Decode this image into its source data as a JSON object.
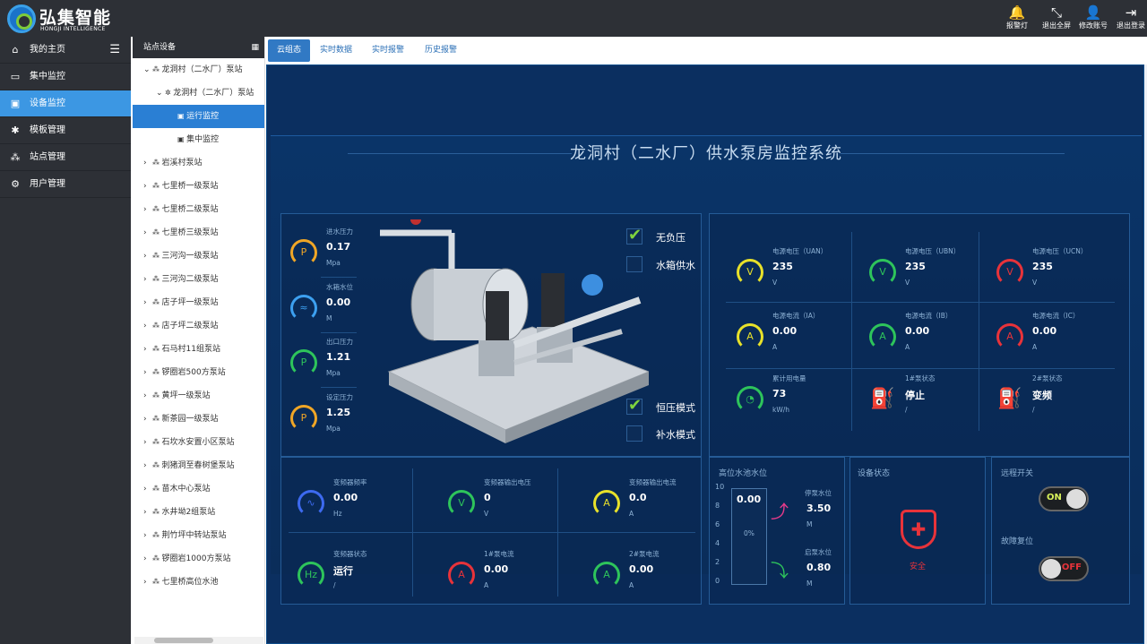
{
  "brand": {
    "name": "弘集智能",
    "sub": "HONGJI INTELLIGENCE"
  },
  "topbar": [
    {
      "icon": "bell-icon",
      "glyph": "🔔",
      "label": "报警灯"
    },
    {
      "icon": "fullscreen-exit-icon",
      "glyph": "⤡",
      "label": "退出全屏"
    },
    {
      "icon": "user-icon",
      "glyph": "👤",
      "label": "修改账号"
    },
    {
      "icon": "logout-icon",
      "glyph": "⇥",
      "label": "退出登录"
    }
  ],
  "nav": [
    {
      "name": "home",
      "icon": "⌂",
      "label": "我的主页"
    },
    {
      "name": "monitor",
      "icon": "▭",
      "label": "集中监控"
    },
    {
      "name": "device",
      "icon": "▣",
      "label": "设备监控",
      "active": true
    },
    {
      "name": "template",
      "icon": "✱",
      "label": "模板管理"
    },
    {
      "name": "site",
      "icon": "⁂",
      "label": "站点管理"
    },
    {
      "name": "user",
      "icon": "⚙",
      "label": "用户管理"
    }
  ],
  "tree": {
    "header": "站点设备",
    "nodes": [
      {
        "label": "龙洞村（二水厂）泵站",
        "level": 0,
        "open": true
      },
      {
        "label": "龙洞村（二水厂）泵站",
        "level": 1,
        "open": true,
        "gear": true
      },
      {
        "label": "运行监控",
        "level": 2,
        "selected": true,
        "leaf": true
      },
      {
        "label": "集中监控",
        "level": 2,
        "leaf": true
      },
      {
        "label": "岩溪村泵站",
        "level": 0
      },
      {
        "label": "七里桥一级泵站",
        "level": 0
      },
      {
        "label": "七里桥二级泵站",
        "level": 0
      },
      {
        "label": "七里桥三级泵站",
        "level": 0
      },
      {
        "label": "三河沟一级泵站",
        "level": 0
      },
      {
        "label": "三河沟二级泵站",
        "level": 0
      },
      {
        "label": "店子坪一级泵站",
        "level": 0
      },
      {
        "label": "店子坪二级泵站",
        "level": 0
      },
      {
        "label": "石马村11组泵站",
        "level": 0
      },
      {
        "label": "锣圈岩500方泵站",
        "level": 0
      },
      {
        "label": "黄坪一级泵站",
        "level": 0
      },
      {
        "label": "新茶园一级泵站",
        "level": 0
      },
      {
        "label": "石坎水安置小区泵站",
        "level": 0
      },
      {
        "label": "刺猪洞至春树堡泵站",
        "level": 0
      },
      {
        "label": "苗木中心泵站",
        "level": 0
      },
      {
        "label": "水井坳2组泵站",
        "level": 0
      },
      {
        "label": "荆竹坪中转站泵站",
        "level": 0
      },
      {
        "label": "锣圈岩1000方泵站",
        "level": 0
      },
      {
        "label": "七里桥高位水池",
        "level": 0
      }
    ]
  },
  "tabs": [
    "云组态",
    "实时数据",
    "实时报警",
    "历史报警"
  ],
  "screen": {
    "title": "龙洞村（二水厂）供水泵房监控系统",
    "left_metrics": [
      {
        "title": "进水压力",
        "value": "0.17",
        "unit": "Mpa",
        "icon": "P",
        "color": "#f0a626"
      },
      {
        "title": "水箱水位",
        "value": "0.00",
        "unit": "M",
        "icon": "≈",
        "color": "#3da0f0"
      },
      {
        "title": "出口压力",
        "value": "1.21",
        "unit": "Mpa",
        "icon": "P",
        "color": "#2ec45b"
      },
      {
        "title": "设定压力",
        "value": "1.25",
        "unit": "Mpa",
        "icon": "P",
        "color": "#f0a626"
      }
    ],
    "modes": [
      {
        "label": "无负压",
        "checked": true
      },
      {
        "label": "水箱供水",
        "checked": false
      },
      {
        "label": "恒压模式",
        "checked": true
      },
      {
        "label": "补水模式",
        "checked": false
      }
    ],
    "electric": [
      {
        "title": "电源电压（UAN）",
        "value": "235",
        "unit": "V",
        "icon": "V",
        "color": "#e8e12a"
      },
      {
        "title": "电源电压（UBN）",
        "value": "235",
        "unit": "V",
        "icon": "V",
        "color": "#2ec45b"
      },
      {
        "title": "电源电压（UCN）",
        "value": "235",
        "unit": "V",
        "icon": "V",
        "color": "#e8333a"
      },
      {
        "title": "电源电流（IA）",
        "value": "0.00",
        "unit": "A",
        "icon": "A",
        "color": "#e8e12a"
      },
      {
        "title": "电源电流（IB）",
        "value": "0.00",
        "unit": "A",
        "icon": "A",
        "color": "#2ec45b"
      },
      {
        "title": "电源电流（IC）",
        "value": "0.00",
        "unit": "A",
        "icon": "A",
        "color": "#e8333a"
      },
      {
        "title": "累计用电量",
        "value": "73",
        "unit": "kW/h",
        "icon": "◔",
        "color": "#2ec45b"
      },
      {
        "title": "1#泵状态",
        "value": "停止",
        "unit": "/",
        "icon": "pump",
        "color": "#3d7ef0"
      },
      {
        "title": "2#泵状态",
        "value": "变频",
        "unit": "/",
        "icon": "pump",
        "color": "#3d7ef0"
      }
    ],
    "inverter": [
      {
        "title": "变频器频率",
        "value": "0.00",
        "unit": "Hz",
        "icon": "∿",
        "color": "#3d6af0"
      },
      {
        "title": "变频器输出电压",
        "value": "0",
        "unit": "V",
        "icon": "V",
        "color": "#2ec45b"
      },
      {
        "title": "变频器输出电流",
        "value": "0.0",
        "unit": "A",
        "icon": "A",
        "color": "#e8e12a"
      },
      {
        "title": "变频器状态",
        "value": "运行",
        "unit": "/",
        "icon": "Hz",
        "color": "#2ec45b"
      },
      {
        "title": "1#泵电流",
        "value": "0.00",
        "unit": "A",
        "icon": "A",
        "color": "#e8333a"
      },
      {
        "title": "2#泵电流",
        "value": "0.00",
        "unit": "A",
        "icon": "A",
        "color": "#2ec45b"
      }
    ],
    "tank": {
      "title": "高位水池水位",
      "scale": [
        "10",
        "8",
        "6",
        "4",
        "2",
        "0"
      ],
      "value": "0.00",
      "percent": "0%",
      "stop_label": "停泵水位",
      "stop_value": "3.50",
      "stop_unit": "M",
      "start_label": "启泵水位",
      "start_value": "0.80",
      "start_unit": "M"
    },
    "device_status": {
      "title": "设备状态",
      "state": "安全"
    },
    "remote": {
      "title": "远程开关",
      "on_label": "ON",
      "reset_title": "故障复位",
      "off_label": "OFF"
    }
  }
}
